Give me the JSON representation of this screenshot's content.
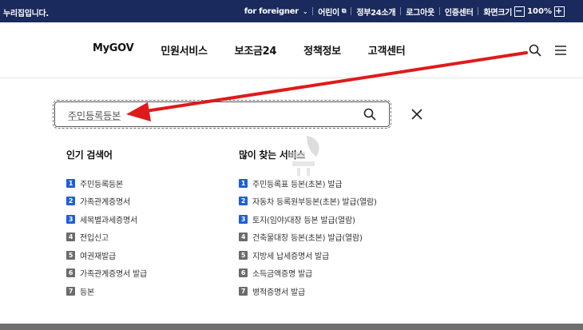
{
  "topbar": {
    "brand": "누리집입니다.",
    "foreigner": "for foreigner",
    "kids": "어린이",
    "gov24": "정부24소개",
    "logout": "로그아웃",
    "cert": "인증센터",
    "zoom_label": "화면크기",
    "zoom_minus": "−",
    "zoom_value": "100%",
    "zoom_plus": "+"
  },
  "nav": {
    "items": [
      "MyGOV",
      "민원서비스",
      "보조금24",
      "정책정보",
      "고객센터"
    ]
  },
  "search": {
    "query": "주민등록등본"
  },
  "popular": {
    "title": "인기 검색어",
    "items": [
      {
        "rank": "1",
        "label": "주민등록등본"
      },
      {
        "rank": "2",
        "label": "가족관계증명서"
      },
      {
        "rank": "3",
        "label": "세목별과세증명서"
      },
      {
        "rank": "4",
        "label": "전입신고"
      },
      {
        "rank": "5",
        "label": "여권재발급"
      },
      {
        "rank": "6",
        "label": "가족관계증명서 발급"
      },
      {
        "rank": "7",
        "label": "등본"
      }
    ]
  },
  "frequent": {
    "title": "많이 찾는 서비스",
    "items": [
      {
        "rank": "1",
        "label": "주민등록표 등본(초본) 발급"
      },
      {
        "rank": "2",
        "label": "자동차 등록원부등본(초본) 발급(열람)"
      },
      {
        "rank": "3",
        "label": "토지(임야)대장 등본 발급(열람)"
      },
      {
        "rank": "4",
        "label": "건축물대장 등본(초본) 발급(열람)"
      },
      {
        "rank": "5",
        "label": "지방세 납세증명서 발급"
      },
      {
        "rank": "6",
        "label": "소득금액증명 발급"
      },
      {
        "rank": "7",
        "label": "병적증명서 발급"
      }
    ]
  },
  "colors": {
    "topbar_bg": "#1a2a5c",
    "rank_hot": "#1e5fd6",
    "rank_cold": "#6b6b6b",
    "annotation_arrow": "#e01a1a"
  },
  "icons": [
    "search-icon",
    "menu-icon",
    "close-icon",
    "external-link-icon",
    "chevron-down-icon"
  ]
}
